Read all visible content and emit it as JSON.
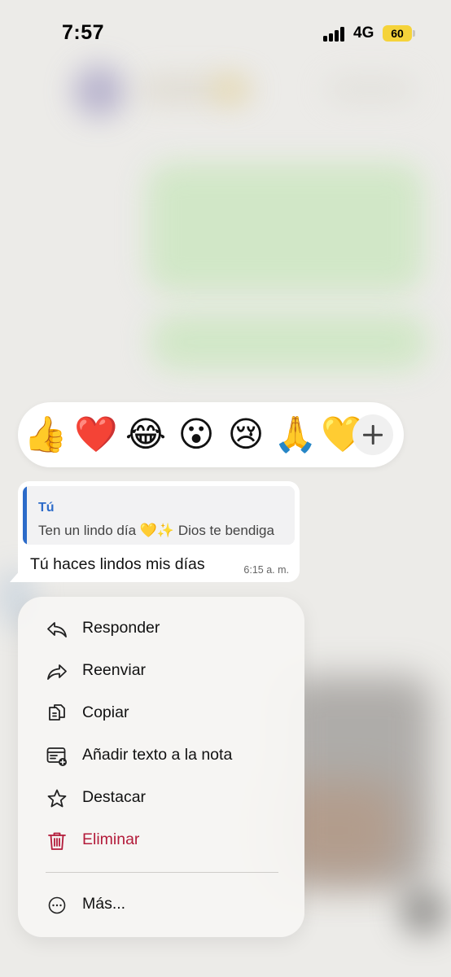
{
  "status_bar": {
    "time": "7:57",
    "network": "4G",
    "battery": "60"
  },
  "reactions": [
    {
      "emoji": "👍",
      "icon": "thumbs-up"
    },
    {
      "emoji": "❤️",
      "icon": "red-heart"
    },
    {
      "emoji": "😂",
      "icon": "tears-of-joy"
    },
    {
      "emoji": "😮",
      "icon": "surprised-face"
    },
    {
      "emoji": "😢",
      "icon": "crying-face"
    },
    {
      "emoji": "🙏",
      "icon": "folded-hands"
    },
    {
      "emoji": "💛",
      "icon": "yellow-heart"
    }
  ],
  "message": {
    "quoted_author": "Tú",
    "quoted_text": "Ten un lindo día 💛✨ Dios te bendiga",
    "text": "Tú haces lindos mis días",
    "time": "6:15 a. m."
  },
  "menu": {
    "reply": "Responder",
    "forward": "Reenviar",
    "copy": "Copiar",
    "add_note": "Añadir texto a la nota",
    "star": "Destacar",
    "delete": "Eliminar",
    "more": "Más..."
  },
  "colors": {
    "accent": "#2c6bc9",
    "danger": "#b31b3a",
    "battery": "#f5d33a"
  }
}
